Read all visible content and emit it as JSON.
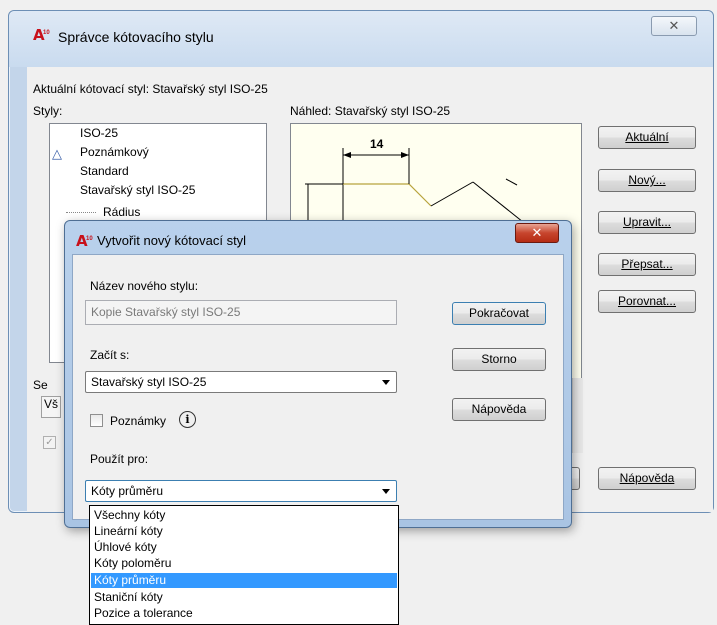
{
  "main_dialog": {
    "title": "Správce kótovacího stylu",
    "close_label": "X",
    "current_style_label": "Aktuální kótovací styl: Stavařský styl ISO-25",
    "styles_label": "Styly:",
    "styles": [
      {
        "label": "ISO-25"
      },
      {
        "label": "Poznámkový",
        "icon": "annotative-icon"
      },
      {
        "label": "Standard"
      },
      {
        "label": "Stavařský styl ISO-25"
      },
      {
        "label": "Rádius"
      }
    ],
    "preview_label": "Náhled: Stavařský styl ISO-25",
    "preview_dimension": "14",
    "partial_list_label": "Se",
    "partial_combo_value": "Vš",
    "buttons": {
      "current": "Aktuální",
      "new": "Nový...",
      "modify": "Upravit...",
      "override": "Přepsat...",
      "compare": "Porovnat...",
      "help": "Nápověda"
    }
  },
  "new_style_dialog": {
    "title": "Vytvořit nový kótovací styl",
    "close_label": "X",
    "name_label": "Název nového stylu:",
    "name_value": "Kopie Stavařský styl ISO-25",
    "start_with_label": "Začít s:",
    "start_with_value": "Stavařský styl ISO-25",
    "annotative_label": "Poznámky",
    "info_glyph": "i",
    "use_for_label": "Použít pro:",
    "use_for_value": "Kóty průměru",
    "buttons": {
      "continue": "Pokračovat",
      "cancel": "Storno",
      "help": "Nápověda"
    }
  },
  "use_for_options": [
    "Všechny kóty",
    "Lineární kóty",
    "Úhlové kóty",
    "Kóty poloměru",
    "Kóty průměru",
    "Staniční kóty",
    "Pozice a tolerance"
  ],
  "use_for_selected_index": 4,
  "colors": {
    "selection": "#3399ff",
    "app_icon_red": "#c8101a",
    "preview_geometry": "#b8a33c"
  }
}
